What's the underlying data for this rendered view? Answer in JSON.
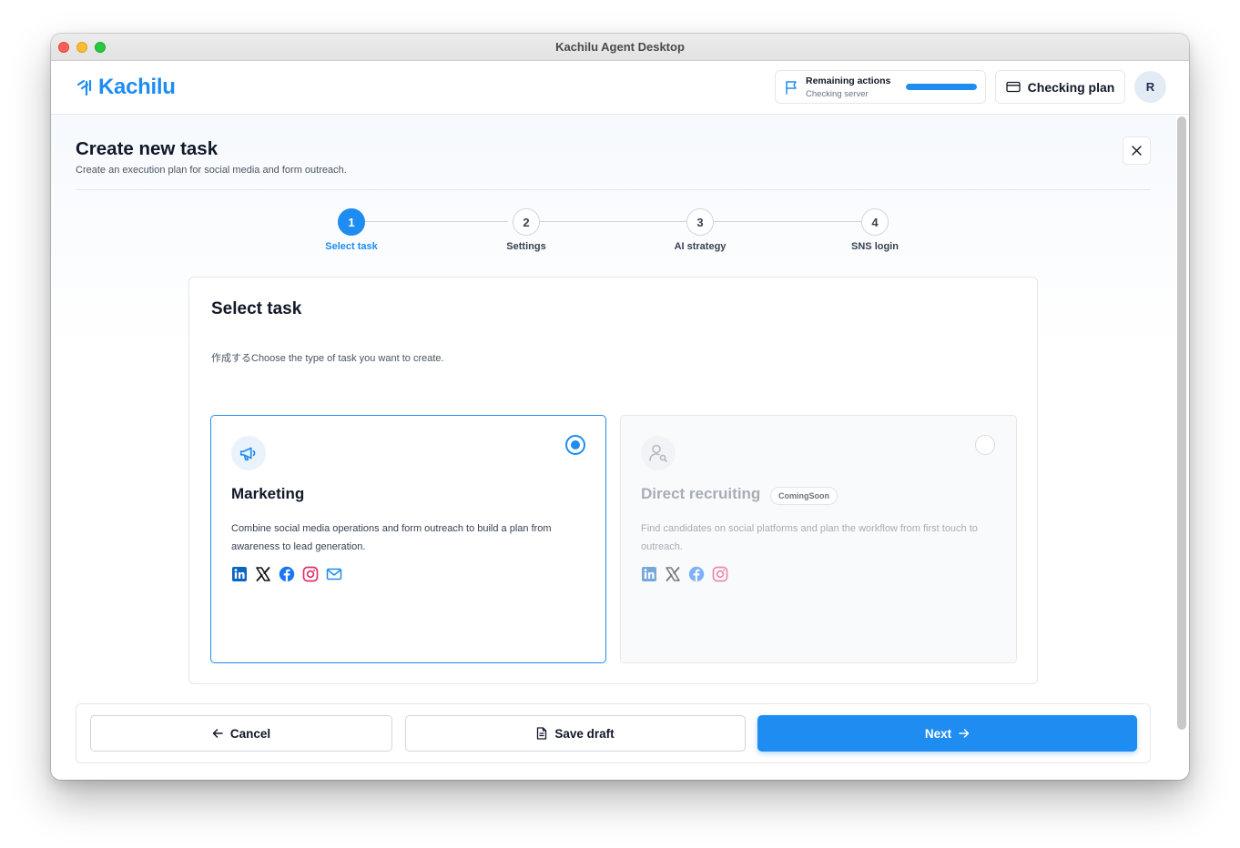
{
  "window": {
    "title": "Kachilu Agent Desktop"
  },
  "header": {
    "logo_text": "Kachilu",
    "remaining": {
      "title": "Remaining actions",
      "subtitle": "Checking server",
      "progress_fraction": 1.0
    },
    "plan_button": "Checking plan",
    "avatar_initial": "R"
  },
  "page": {
    "title": "Create new task",
    "subtitle": "Create an execution plan for social media and form outreach."
  },
  "steps": [
    {
      "number": "1",
      "label": "Select task",
      "active": true
    },
    {
      "number": "2",
      "label": "Settings",
      "active": false
    },
    {
      "number": "3",
      "label": "AI strategy",
      "active": false
    },
    {
      "number": "4",
      "label": "SNS login",
      "active": false
    }
  ],
  "panel": {
    "title": "Select task",
    "subtitle": "作成するChoose the type of task you want to create."
  },
  "cards": [
    {
      "title": "Marketing",
      "description": "Combine social media operations and form outreach to build a plan from awareness to lead generation.",
      "selected": true,
      "icons": [
        "linkedin-icon",
        "x-icon",
        "facebook-icon",
        "instagram-icon",
        "mail-icon"
      ]
    },
    {
      "title": "Direct recruiting",
      "badge": "ComingSoon",
      "description": "Find candidates on social platforms and plan the workflow from first touch to outreach.",
      "selected": false,
      "disabled": true,
      "icons": [
        "linkedin-icon",
        "x-icon",
        "facebook-icon",
        "instagram-icon"
      ]
    }
  ],
  "footer": {
    "cancel": "Cancel",
    "save_draft": "Save draft",
    "next": "Next"
  },
  "colors": {
    "accent": "#1e8cf0",
    "linkedin": "#0a66c2",
    "facebook": "#1877f2",
    "instagram": "#e1306c"
  }
}
